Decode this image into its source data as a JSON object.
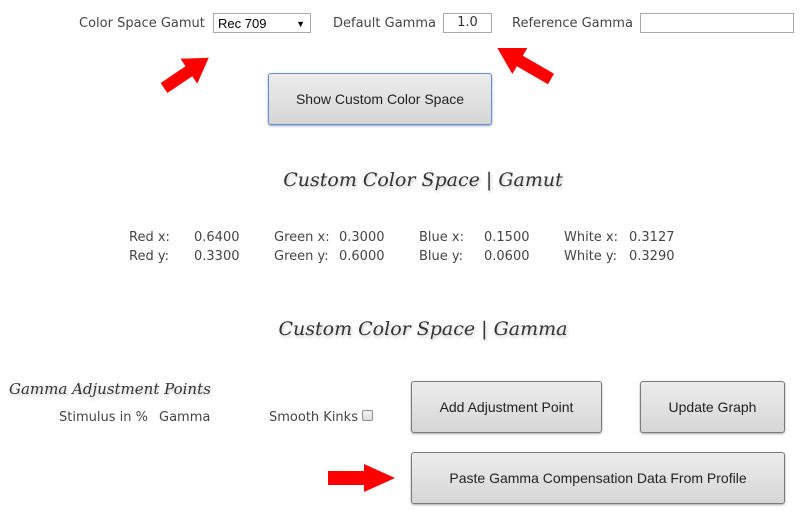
{
  "top_controls": {
    "gamut_label": "Color Space Gamut",
    "gamut_selected": "Rec 709",
    "gamut_caret": "▼",
    "default_gamma_label": "Default Gamma",
    "default_gamma_value": "1.0",
    "reference_gamma_label": "Reference Gamma",
    "reference_gamma_value": ""
  },
  "show_custom_button": "Show Custom Color Space",
  "gamut_section": {
    "title": "Custom Color Space | Gamut",
    "rows": [
      {
        "red_label": "Red x:",
        "red_value": "0.6400",
        "green_label": "Green x:",
        "green_value": "0.3000",
        "blue_label": "Blue x:",
        "blue_value": "0.1500",
        "white_label": "White x:",
        "white_value": "0.3127"
      },
      {
        "red_label": "Red y:",
        "red_value": "0.3300",
        "green_label": "Green y:",
        "green_value": "0.6000",
        "blue_label": "Blue y:",
        "blue_value": "0.0600",
        "white_label": "White y:",
        "white_value": "0.3290"
      }
    ]
  },
  "gamma_section": {
    "title": "Custom Color Space | Gamma",
    "adjustment_title": "Gamma Adjustment Points",
    "stimulus_header": "Stimulus in %",
    "gamma_header": "Gamma",
    "smooth_kinks_label": "Smooth Kinks",
    "smooth_kinks_checked": false,
    "add_point_button": "Add Adjustment Point",
    "update_graph_button": "Update Graph",
    "paste_button": "Paste Gamma Compensation Data From Profile"
  },
  "annotation_color": "#ff0000"
}
